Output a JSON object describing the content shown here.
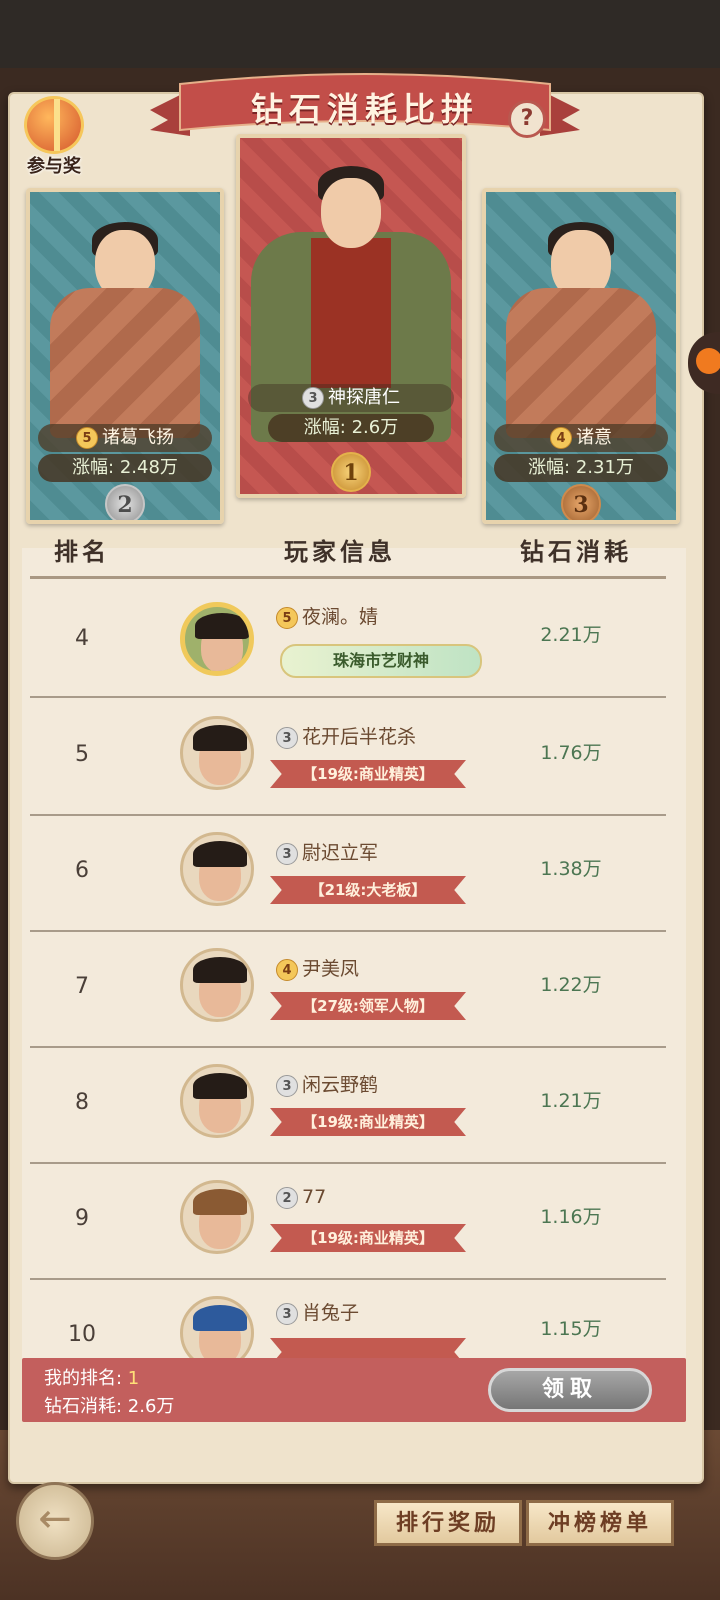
{
  "header": {
    "title": "钻石消耗比拼",
    "help_label": "?",
    "participation_label": "参与奖"
  },
  "podium": [
    {
      "place_medal": "2",
      "name": "诸葛飞扬",
      "vip": "5",
      "gain": "涨幅: 2.48万"
    },
    {
      "place_medal": "1",
      "name": "神探唐仁",
      "vip": "3",
      "gain": "涨幅: 2.6万"
    },
    {
      "place_medal": "3",
      "name": "诸意",
      "vip": "4",
      "gain": "涨幅: 2.31万"
    }
  ],
  "columns": {
    "rank": "排名",
    "player": "玩家信息",
    "cost": "钻石消耗"
  },
  "rows": [
    {
      "rank": "4",
      "name": "夜澜。婧",
      "vip": "5",
      "title": "珠海市艺财神",
      "cost": "2.21万"
    },
    {
      "rank": "5",
      "name": "花开后半花杀",
      "vip": "3",
      "title": "【19级:商业精英】",
      "cost": "1.76万"
    },
    {
      "rank": "6",
      "name": "尉迟立军",
      "vip": "3",
      "title": "【21级:大老板】",
      "cost": "1.38万"
    },
    {
      "rank": "7",
      "name": "尹美凤",
      "vip": "4",
      "title": "【27级:领军人物】",
      "cost": "1.22万"
    },
    {
      "rank": "8",
      "name": "闲云野鹤",
      "vip": "3",
      "title": "【19级:商业精英】",
      "cost": "1.21万"
    },
    {
      "rank": "9",
      "name": "77",
      "vip": "2",
      "title": "【19级:商业精英】",
      "cost": "1.16万"
    },
    {
      "rank": "10",
      "name": "肖兔子",
      "vip": "3",
      "title": "",
      "cost": "1.15万"
    }
  ],
  "my_info": {
    "rank_label": "我的排名: ",
    "rank_value": "1",
    "cost_label": "钻石消耗: 2.6万",
    "claim_label": "领取"
  },
  "bottom": {
    "back_icon": "←",
    "reward_label": "排行奖励",
    "list_label": "冲榜榜单"
  },
  "colors": {
    "accent_red": "#c35f5d",
    "cost_green": "#4c7652",
    "paper": "#efe3cc"
  }
}
